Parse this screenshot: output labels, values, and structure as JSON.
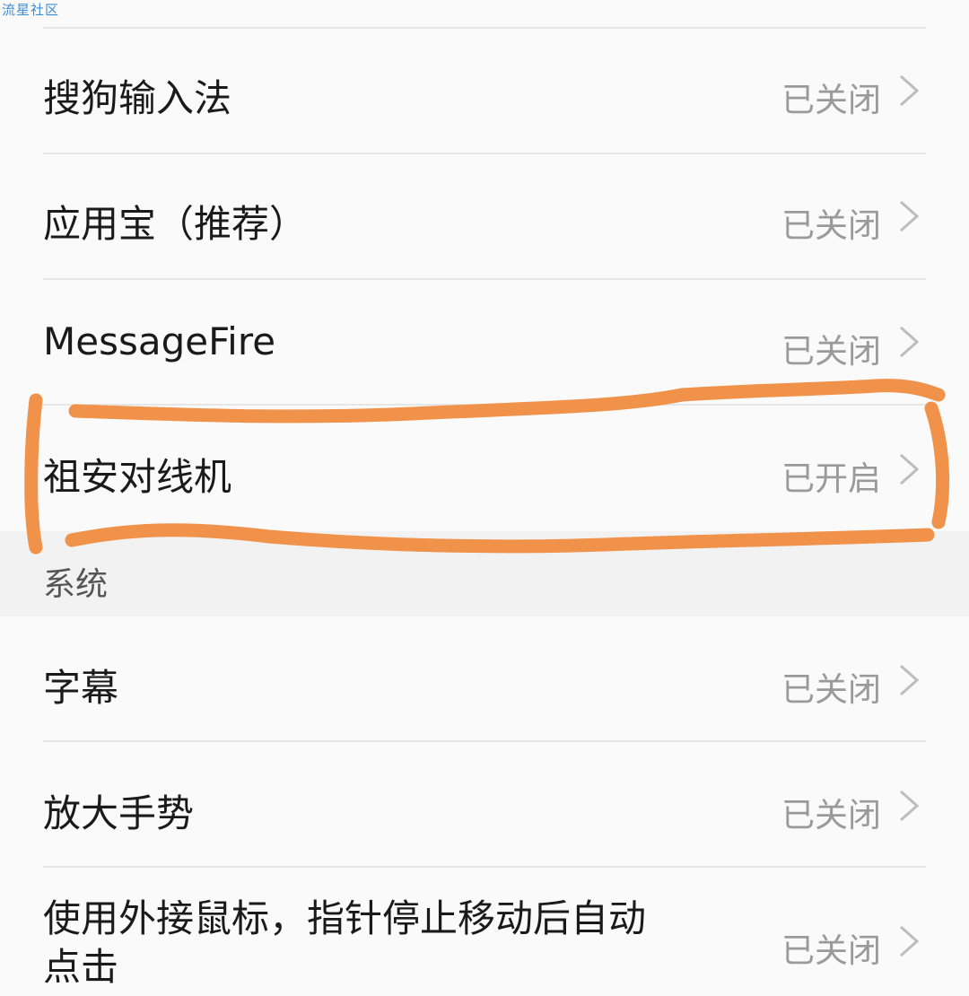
{
  "watermark": "流星社区",
  "items_top": [
    {
      "label": "搜狗输入法",
      "status": "已关闭"
    },
    {
      "label": "应用宝（推荐）",
      "status": "已关闭"
    },
    {
      "label": "MessageFire",
      "status": "已关闭"
    },
    {
      "label": "祖安对线机",
      "status": "已开启"
    }
  ],
  "section": {
    "title": "系统"
  },
  "items_system": [
    {
      "label": "字幕",
      "status": "已关闭"
    },
    {
      "label": "放大手势",
      "status": "已关闭"
    },
    {
      "label": "使用外接鼠标，指针停止移动后自动点击",
      "status": "已关闭"
    }
  ],
  "colors": {
    "highlight_stroke": "#f0924a",
    "status_text": "#9a9a9a",
    "watermark": "#3b8fd9"
  },
  "icons": {
    "chevron": "chevron-right-icon"
  }
}
